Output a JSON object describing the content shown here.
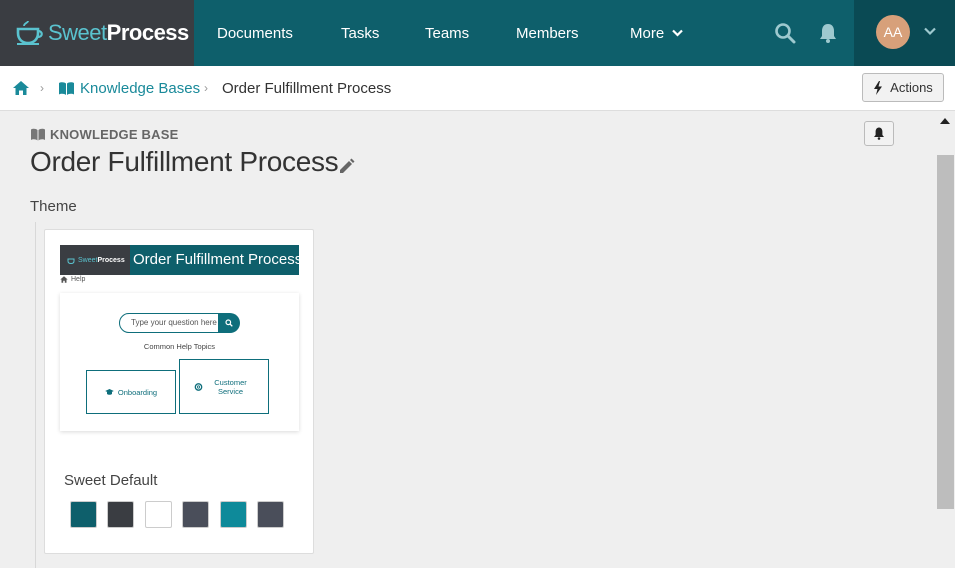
{
  "app": {
    "logo_sweet": "Sweet",
    "logo_process": "Process"
  },
  "nav": {
    "items": [
      "Documents",
      "Tasks",
      "Teams",
      "Members",
      "More"
    ],
    "avatar_initials": "AA"
  },
  "breadcrumb": {
    "items": [
      "Knowledge Bases",
      "Order Fulfillment Process"
    ],
    "actions_label": "Actions"
  },
  "page": {
    "section_label": "KNOWLEDGE BASE",
    "title": "Order Fulfillment Process",
    "theme_label": "Theme"
  },
  "theme_card": {
    "preview": {
      "logo_sweet": "Sweet",
      "logo_process": "Process",
      "title": "Order Fulfillment Process",
      "crumb": "Help",
      "search_placeholder": "Type your question here",
      "topics_heading": "Common Help Topics",
      "topics": [
        "Onboarding",
        "Customer Service"
      ]
    },
    "name": "Sweet Default",
    "swatches": [
      "#0e5f6b",
      "#3a3d42",
      "#ffffff",
      "#4a4e5a",
      "#0e8a9a",
      "#4a4e5a"
    ]
  },
  "colors": {
    "nav_bg": "#0e5f6b",
    "logo_bg": "#3a3d42",
    "accent": "#1a8a9a",
    "avatar": "#d7a07a"
  }
}
